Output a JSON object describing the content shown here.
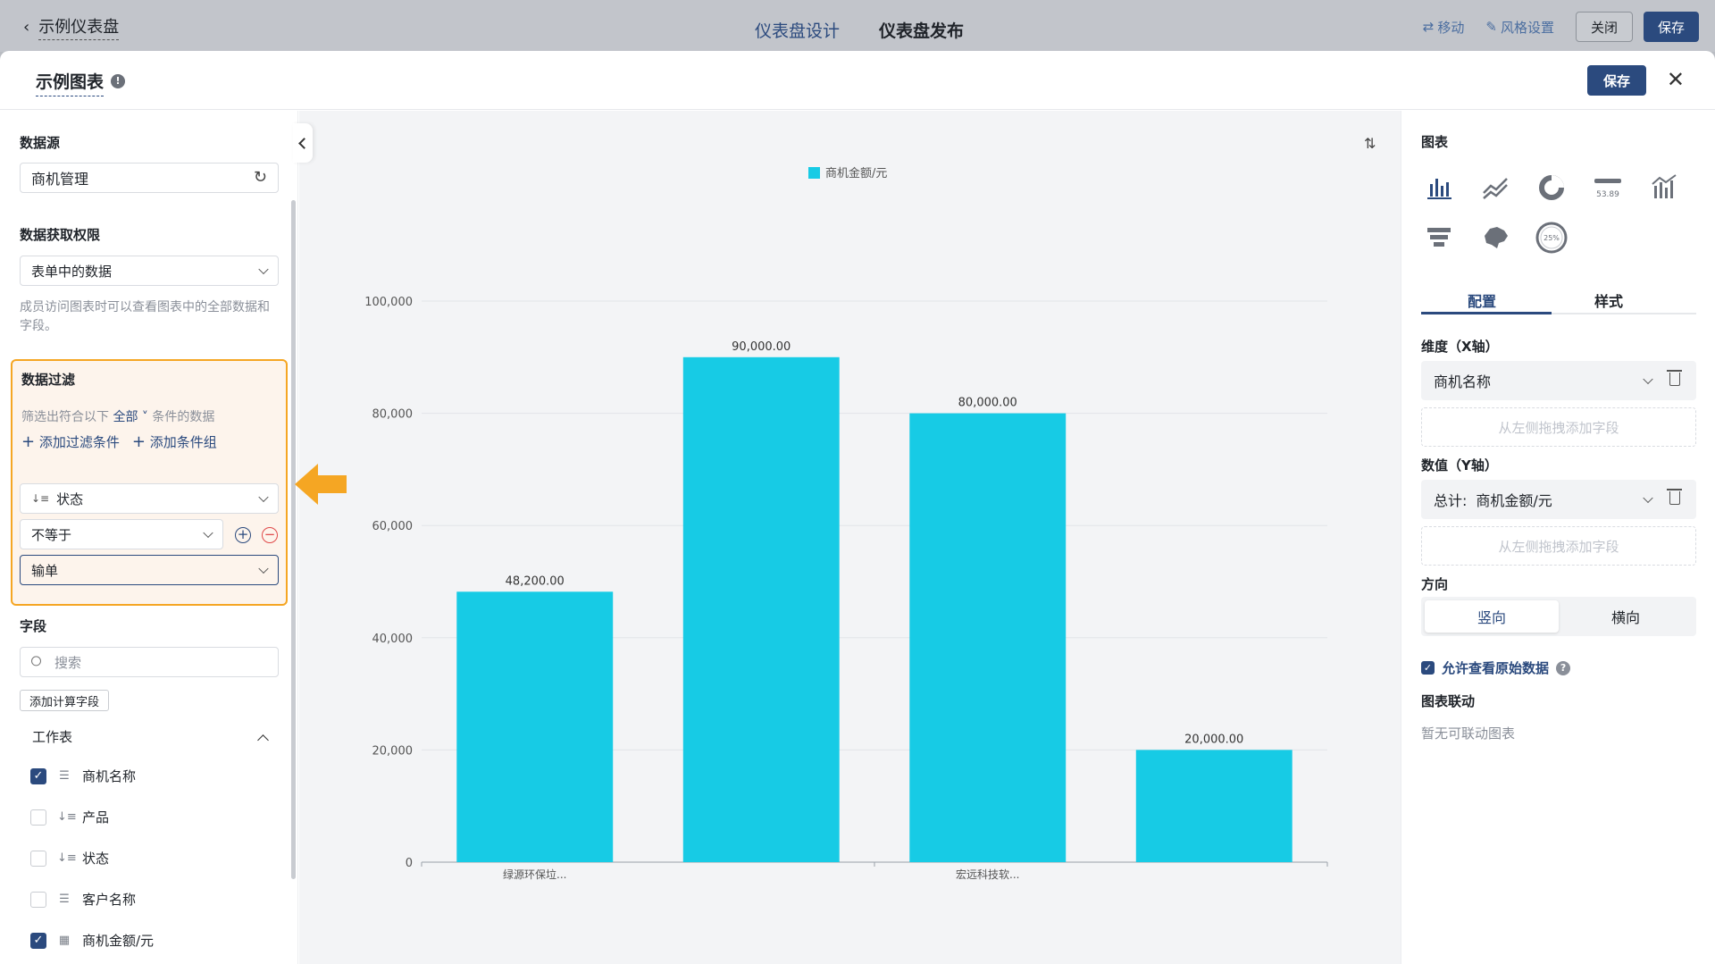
{
  "topbar": {
    "back_label": "示例仪表盘",
    "tab_design": "仪表盘设计",
    "tab_publish": "仪表盘发布",
    "move_label": "移动",
    "style_label": "风格设置",
    "close_label": "关闭",
    "save_label": "保存"
  },
  "modal": {
    "title": "示例图表",
    "save_label": "保存"
  },
  "left": {
    "datasource_label": "数据源",
    "datasource_value": "商机管理",
    "permission_label": "数据获取权限",
    "permission_value": "表单中的数据",
    "permission_hint": "成员访问图表时可以查看图表中的全部数据和字段。",
    "filter_label": "数据过滤",
    "filter_desc_pre": "筛选出符合以下",
    "filter_desc_all": "全部",
    "filter_desc_post": "条件的数据",
    "add_filter": "添加过滤条件",
    "add_group": "添加条件组",
    "filter_field": "状态",
    "filter_operator": "不等于",
    "filter_value": "输单",
    "fields_label": "字段",
    "search_placeholder": "搜索",
    "add_calc_field": "添加计算字段",
    "worksheet_label": "工作表",
    "fields": [
      {
        "label": "商机名称",
        "checked": true,
        "type_icon": "text-icon"
      },
      {
        "label": "产品",
        "checked": false,
        "type_icon": "sort-icon"
      },
      {
        "label": "状态",
        "checked": false,
        "type_icon": "sort-icon"
      },
      {
        "label": "客户名称",
        "checked": false,
        "type_icon": "text-icon"
      },
      {
        "label": "商机金额/元",
        "checked": true,
        "type_icon": "number-icon"
      }
    ]
  },
  "right": {
    "chart_label": "图表",
    "tab_config": "配置",
    "tab_style": "样式",
    "dim_label": "维度（X轴）",
    "dim_value": "商机名称",
    "dropzone_text": "从左侧拖拽添加字段",
    "val_label": "数值（Y轴）",
    "val_prefix": "总计:",
    "val_value": "商机金额/元",
    "dir_label": "方向",
    "dir_vertical": "竖向",
    "dir_horizontal": "横向",
    "allow_raw": "允许查看原始数据",
    "linkage_label": "图表联动",
    "linkage_empty": "暂无可联动图表",
    "card_value_icon_text": "53.89",
    "gauge_icon_text": "25%"
  },
  "colors": {
    "accent": "#2b4a7e",
    "bar": "#17cbe5",
    "highlight": "#f5a623"
  },
  "chart_data": {
    "type": "bar",
    "legend": "商机金额/元",
    "categories": [
      "绿源环保垃...",
      "",
      "宏远科技软...",
      ""
    ],
    "values": [
      48200,
      90000,
      80000,
      20000
    ],
    "value_labels": [
      "48,200.00",
      "90,000.00",
      "80,000.00",
      "20,000.00"
    ],
    "yticks": [
      0,
      20000,
      40000,
      60000,
      80000,
      100000
    ],
    "ytick_labels": [
      "0",
      "20,000",
      "40,000",
      "60,000",
      "80,000",
      "100,000"
    ],
    "ylim": [
      0,
      100000
    ],
    "grid": true,
    "legend_position": "top-center"
  }
}
